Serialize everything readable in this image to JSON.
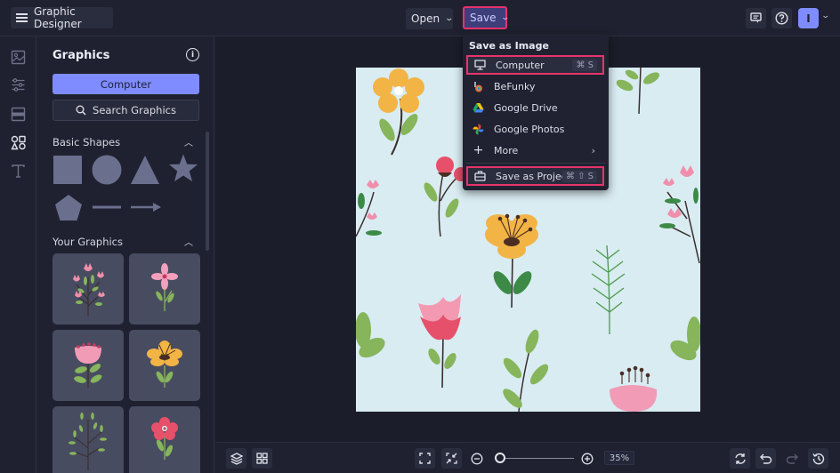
{
  "topbar": {
    "app_title": "Graphic Designer",
    "open_label": "Open",
    "save_label": "Save",
    "avatar_initial": "I",
    "icons": [
      "menu-icon",
      "comment-icon",
      "help-icon",
      "chevron-down-icon"
    ]
  },
  "rail": {
    "items": [
      {
        "name": "photos",
        "icon": "image-icon"
      },
      {
        "name": "adjust",
        "icon": "sliders-icon"
      },
      {
        "name": "layout",
        "icon": "layout-icon"
      },
      {
        "name": "graphics",
        "icon": "shapes-icon",
        "active": true
      },
      {
        "name": "text",
        "icon": "text-icon"
      }
    ]
  },
  "panel": {
    "title": "Graphics",
    "computer_button": "Computer",
    "search_button": "Search Graphics",
    "basic_shapes_title": "Basic Shapes",
    "basic_shapes": [
      "square",
      "circle",
      "triangle",
      "star",
      "pentagon",
      "line",
      "arrow"
    ],
    "your_graphics_title": "Your Graphics",
    "your_graphics": [
      "pink-tulip-bouquet",
      "pink-star-flower",
      "pink-peony",
      "yellow-flower",
      "green-sprig",
      "red-flower"
    ]
  },
  "save_menu": {
    "header": "Save as Image",
    "items": [
      {
        "label": "Computer",
        "icon": "monitor-icon",
        "shortcut": "⌘ S",
        "highlighted": true
      },
      {
        "label": "BeFunky",
        "icon": "befunky-icon"
      },
      {
        "label": "Google Drive",
        "icon": "google-drive-icon"
      },
      {
        "label": "Google Photos",
        "icon": "google-photos-icon"
      },
      {
        "label": "More",
        "icon": "plus-icon",
        "submenu": true
      }
    ],
    "project_item": {
      "label": "Save as Project",
      "icon": "briefcase-icon",
      "shortcut": "⌘ ⇧ S",
      "highlighted": true
    }
  },
  "bottombar": {
    "zoom_value": "35%",
    "zoom_level_fraction": 0.05,
    "redo_disabled": true
  },
  "colors": {
    "accent": "#7f8cff",
    "highlight_border": "#e8336b",
    "canvas_bg": "#d9ecf2",
    "app_bg": "#1f2130"
  }
}
